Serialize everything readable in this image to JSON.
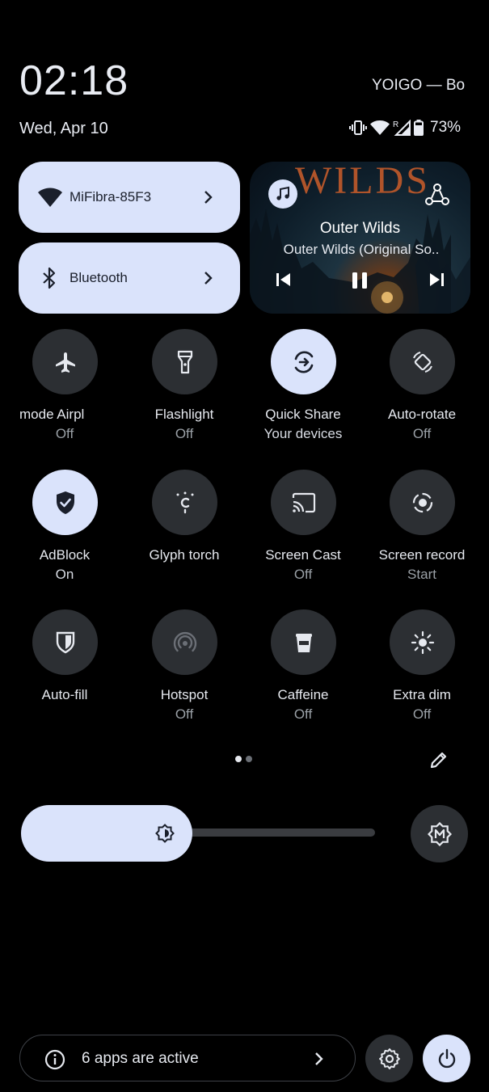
{
  "status": {
    "time": "02:18",
    "carrier": "YOIGO — Bou",
    "date": "Wed, Apr 10",
    "battery": "73%"
  },
  "wifi_tile": {
    "label": "MiFibra-85F3"
  },
  "bluetooth_tile": {
    "label": "Bluetooth"
  },
  "media": {
    "art_text": "WILDS",
    "title": "Outer Wilds",
    "subtitle": "Outer Wilds (Original So.."
  },
  "tiles": [
    {
      "label": "mode     Airpl",
      "state": "Off"
    },
    {
      "label": "Flashlight",
      "state": "Off"
    },
    {
      "label": "Quick Share",
      "state": "Your devices"
    },
    {
      "label": "Auto-rotate",
      "state": "Off"
    },
    {
      "label": "AdBlock",
      "state": "On"
    },
    {
      "label": "Glyph torch",
      "state": ""
    },
    {
      "label": "Screen Cast",
      "state": "Off"
    },
    {
      "label": "Screen record",
      "state": "Start"
    },
    {
      "label": "Auto-fill",
      "state": ""
    },
    {
      "label": "Hotspot",
      "state": "Off"
    },
    {
      "label": "Caffeine",
      "state": "Off"
    },
    {
      "label": "Extra dim",
      "state": "Off"
    }
  ],
  "pager": {
    "pages": 2,
    "current": 1
  },
  "brightness": {
    "level": 0.43
  },
  "footer": {
    "active_apps": "6 apps are active"
  },
  "colors": {
    "accent": "#dae3fb",
    "tile_off": "#2c2f33",
    "background": "#000000"
  }
}
